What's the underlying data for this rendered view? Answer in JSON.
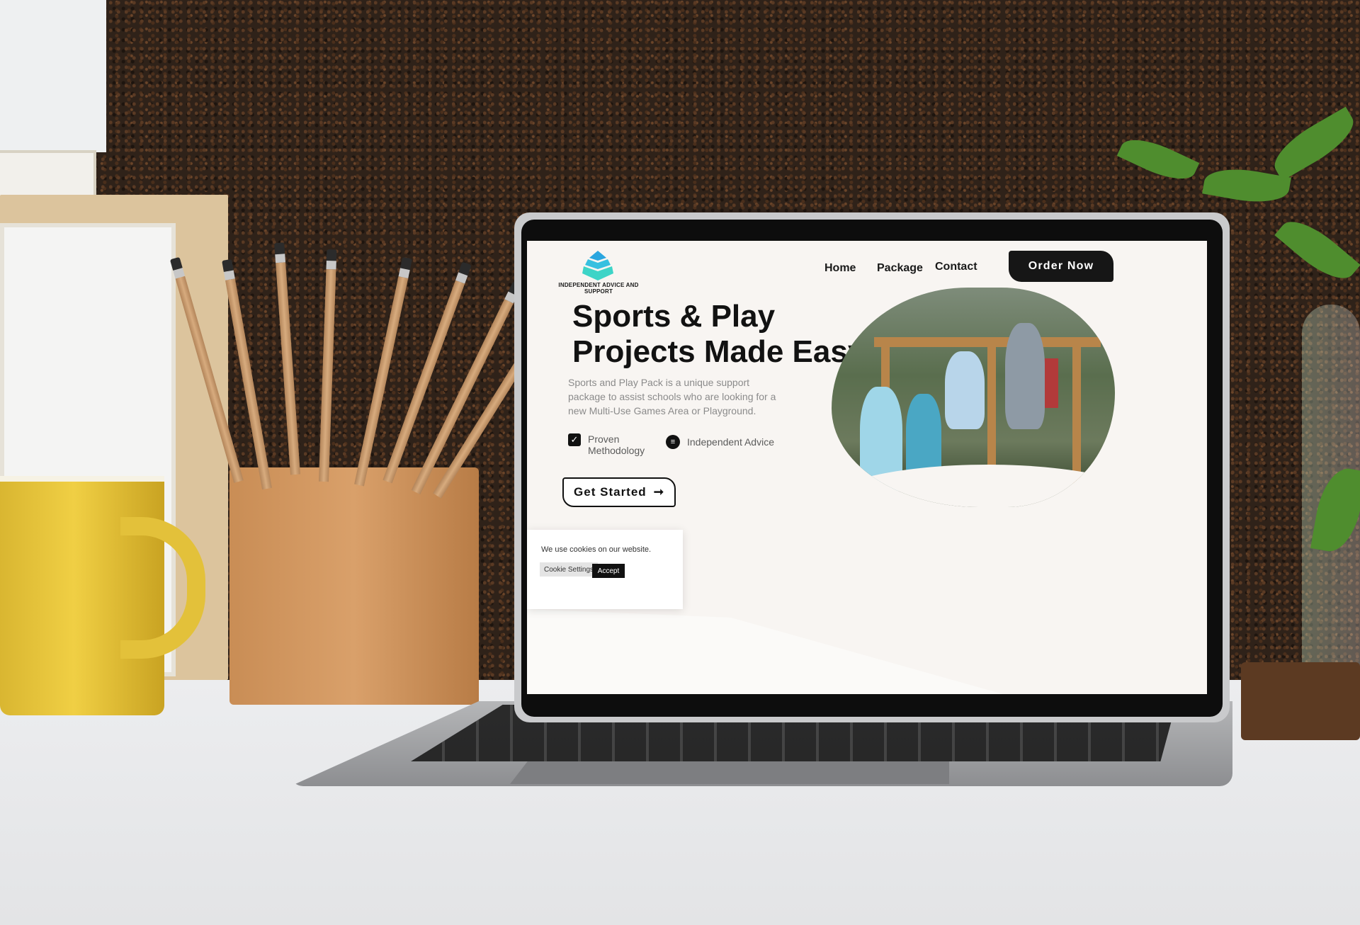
{
  "site": {
    "logo_text": "INDEPENDENT ADVICE AND SUPPORT",
    "nav": [
      {
        "label": "Home"
      },
      {
        "label": "Package"
      },
      {
        "label": "Contact"
      }
    ],
    "order_button": "Order Now"
  },
  "hero": {
    "title_line1": "Sports & Play",
    "title_line2": "Projects Made Easy",
    "description": "Sports and Play Pack is a unique support package to assist schools who are looking for a new Multi-Use Games Area or Playground.",
    "features": [
      {
        "icon": "checkbox-icon",
        "label": "Proven Methodology"
      },
      {
        "icon": "document-icon",
        "label": "Independent Advice"
      }
    ],
    "cta_label": "Get Started",
    "cta_icon": "arrow-right-icon"
  },
  "cookie_banner": {
    "message": "We use cookies on our website.",
    "settings_label": "Cookie Settings",
    "accept_label": "Accept"
  },
  "colors": {
    "page_bg": "#f8f5f2",
    "dark": "#161616",
    "logo_blue": "#2aa6df",
    "logo_teal": "#3dd4c7"
  }
}
